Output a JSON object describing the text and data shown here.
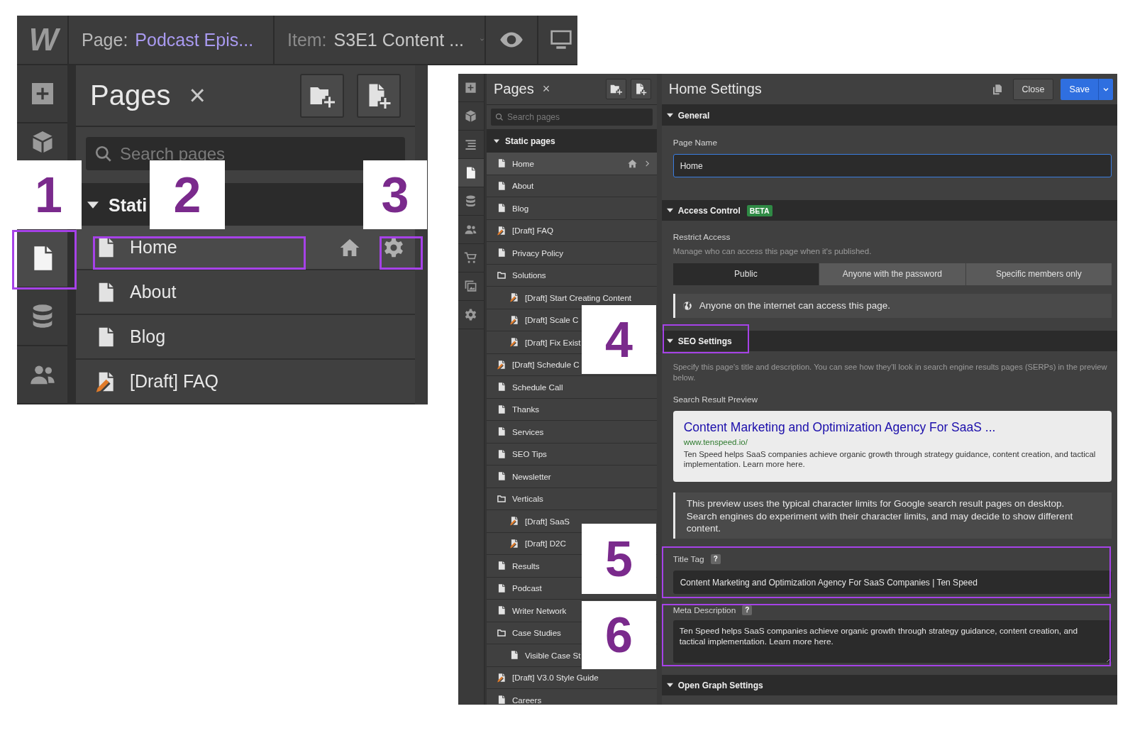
{
  "left_screenshot": {
    "top_bar": {
      "logo": "W",
      "page_label": "Page:",
      "page_value": "Podcast Epis...",
      "item_label": "Item:",
      "item_value": "S3E1 Content ..."
    },
    "rail": [
      {
        "kind": "add",
        "selected": false
      },
      {
        "kind": "components",
        "selected": false
      },
      {
        "kind": "pages",
        "selected": true
      },
      {
        "kind": "cms",
        "selected": false
      },
      {
        "kind": "users",
        "selected": false
      }
    ],
    "pages_panel": {
      "title": "Pages",
      "close": "×",
      "search": {
        "placeholder": "Search pages"
      },
      "section": "Stati",
      "items": [
        {
          "label": "Home",
          "kind": "home",
          "selected": true
        },
        {
          "label": "About",
          "kind": "page",
          "selected": false
        },
        {
          "label": "Blog",
          "kind": "page",
          "selected": false
        },
        {
          "label": "[Draft] FAQ",
          "kind": "draft",
          "selected": false
        }
      ]
    }
  },
  "right_screenshot": {
    "rail": [
      {
        "kind": "add",
        "selected": false
      },
      {
        "kind": "components",
        "selected": false
      },
      {
        "kind": "navigator",
        "selected": false
      },
      {
        "kind": "pages",
        "selected": true
      },
      {
        "kind": "cms",
        "selected": false
      },
      {
        "kind": "users",
        "selected": false
      },
      {
        "kind": "ecommerce",
        "selected": false
      },
      {
        "kind": "assets",
        "selected": false
      },
      {
        "kind": "settings",
        "selected": false
      }
    ],
    "pages_panel": {
      "title": "Pages",
      "close": "×",
      "search": {
        "placeholder": "Search pages"
      },
      "section": "Static pages",
      "items": [
        {
          "label": "Home",
          "kind": "home",
          "selected": true
        },
        {
          "label": "About",
          "kind": "page",
          "selected": false
        },
        {
          "label": "Blog",
          "kind": "page",
          "selected": false
        },
        {
          "label": "[Draft] FAQ",
          "kind": "draft",
          "selected": false
        },
        {
          "label": "Privacy Policy",
          "kind": "page",
          "selected": false
        },
        {
          "label": "Solutions",
          "kind": "folder",
          "selected": false,
          "children": [
            {
              "label": "[Draft] Start Creating Content",
              "kind": "draft",
              "selected": false
            },
            {
              "label": "[Draft] Scale C",
              "kind": "draft",
              "selected": false
            },
            {
              "label": "[Draft] Fix Exist",
              "kind": "draft",
              "selected": false
            }
          ]
        },
        {
          "label": "[Draft] Schedule C",
          "kind": "draft",
          "selected": false
        },
        {
          "label": "Schedule Call",
          "kind": "page",
          "selected": false
        },
        {
          "label": "Thanks",
          "kind": "page",
          "selected": false
        },
        {
          "label": "Services",
          "kind": "page",
          "selected": false
        },
        {
          "label": "SEO Tips",
          "kind": "page",
          "selected": false
        },
        {
          "label": "Newsletter",
          "kind": "page",
          "selected": false
        },
        {
          "label": "Verticals",
          "kind": "folder",
          "selected": false,
          "children": [
            {
              "label": "[Draft] SaaS",
              "kind": "draft",
              "selected": false
            },
            {
              "label": "[Draft] D2C",
              "kind": "draft",
              "selected": false
            }
          ]
        },
        {
          "label": "Results",
          "kind": "page",
          "selected": false
        },
        {
          "label": "Podcast",
          "kind": "page",
          "selected": false
        },
        {
          "label": "Writer Network",
          "kind": "page",
          "selected": false
        },
        {
          "label": "Case Studies",
          "kind": "folder",
          "selected": false,
          "children": [
            {
              "label": "Visible Case St",
              "kind": "page",
              "selected": false
            }
          ]
        },
        {
          "label": "[Draft] V3.0 Style Guide",
          "kind": "draft",
          "selected": false
        },
        {
          "label": "Careers",
          "kind": "page",
          "selected": false
        }
      ]
    },
    "settings": {
      "title": "Home Settings",
      "close": "Close",
      "save": "Save",
      "general": {
        "heading": "General",
        "page_name_label": "Page Name",
        "page_name_value": "Home"
      },
      "access": {
        "heading": "Access Control",
        "badge": "BETA",
        "label": "Restrict Access",
        "hint": "Manage who can access this page when it's published.",
        "options": [
          {
            "label": "Public",
            "selected": true
          },
          {
            "label": "Anyone with the password",
            "selected": false
          },
          {
            "label": "Specific members only",
            "selected": false
          }
        ],
        "info": "Anyone on the internet can access this page."
      },
      "seo": {
        "heading": "SEO Settings",
        "description": "Specify this page's title and description. You can see how they'll look in search engine results pages (SERPs) in the preview below.",
        "preview_label": "Search Result Preview",
        "preview": {
          "title": "Content Marketing and Optimization Agency For SaaS ...",
          "url": "www.tenspeed.io/",
          "snippet": "Ten Speed helps SaaS companies achieve organic growth through strategy guidance, content creation, and tactical implementation. Learn more here."
        },
        "note": "This preview uses the typical character limits for Google search result pages on desktop. Search engines do experiment with their character limits, and may decide to show different content.",
        "title_tag": {
          "label": "Title Tag",
          "help": "?",
          "value": "Content Marketing and Optimization Agency For SaaS Companies | Ten Speed"
        },
        "meta_description": {
          "label": "Meta Description",
          "help": "?",
          "value": "Ten Speed helps SaaS companies achieve organic growth through strategy guidance, content creation, and tactical implementation. Learn more here."
        }
      },
      "open_graph": {
        "heading": "Open Graph Settings"
      }
    }
  },
  "callouts": [
    "1",
    "2",
    "3",
    "4",
    "5",
    "6"
  ]
}
